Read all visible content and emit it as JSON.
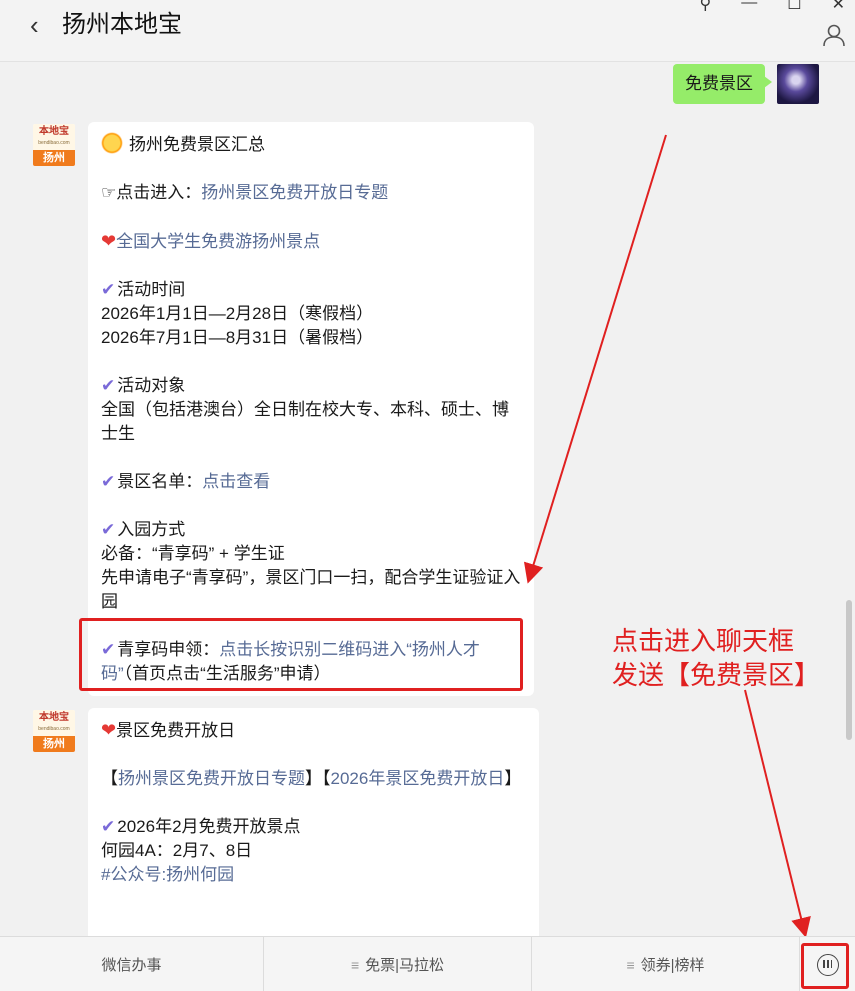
{
  "header": {
    "back_glyph": "‹",
    "title": "扬州本地宝",
    "window_buttons": [
      "⚲",
      "—",
      "☐",
      "✕"
    ]
  },
  "my_message": {
    "text": "免费景区"
  },
  "bot_avatar": {
    "brand": "本地宝",
    "site": "bendibao.com",
    "city": "扬州"
  },
  "message1": {
    "heading": "扬州免费景区汇总",
    "line_enter_prefix": "☞点击进入：",
    "line_enter_link": "扬州景区免费开放日专题",
    "line_students_link": "全国大学生免费游扬州景点",
    "activity_time_label": "活动时间",
    "activity_time_1": "2026年1月1日—2月28日（寒假档）",
    "activity_time_2": "2026年7月1日—8月31日（暑假档）",
    "target_label": "活动对象",
    "target_text": "全国（包括港澳台）全日制在校大专、本科、硕士、博士生",
    "list_prefix": "景区名单：",
    "list_link": "点击查看",
    "entry_label": "入园方式",
    "entry_required": "必备：“青享码” + 学生证",
    "entry_steps": "先申请电子“青享码”，景区门口一扫，配合学生证验证入园",
    "qxm_prefix": "青享码申领：",
    "qxm_link": "点击长按识别二维码进入“扬州人才码”",
    "qxm_suffix": "（首页点击“生活服务”申请）"
  },
  "message2": {
    "heading": "景区免费开放日",
    "bracket_1": "扬州景区免费开放日专题",
    "bracket_2": "2026年景区免费开放日",
    "feb_label": "2026年2月免费开放景点",
    "heyuan": "何园4A：2月7、8日",
    "hashtag": "#公众号:扬州何园"
  },
  "annotation": {
    "line1": "点击进入聊天框",
    "line2": "发送【免费景区】"
  },
  "menu": {
    "items": [
      {
        "label": "微信办事",
        "has_menu": false
      },
      {
        "label": "免票|马拉松",
        "has_menu": true
      },
      {
        "label": "领券|榜样",
        "has_menu": true
      }
    ]
  },
  "colors": {
    "annotation_red": "#e02020",
    "link": "#576b95",
    "my_bubble": "#95ec69"
  }
}
